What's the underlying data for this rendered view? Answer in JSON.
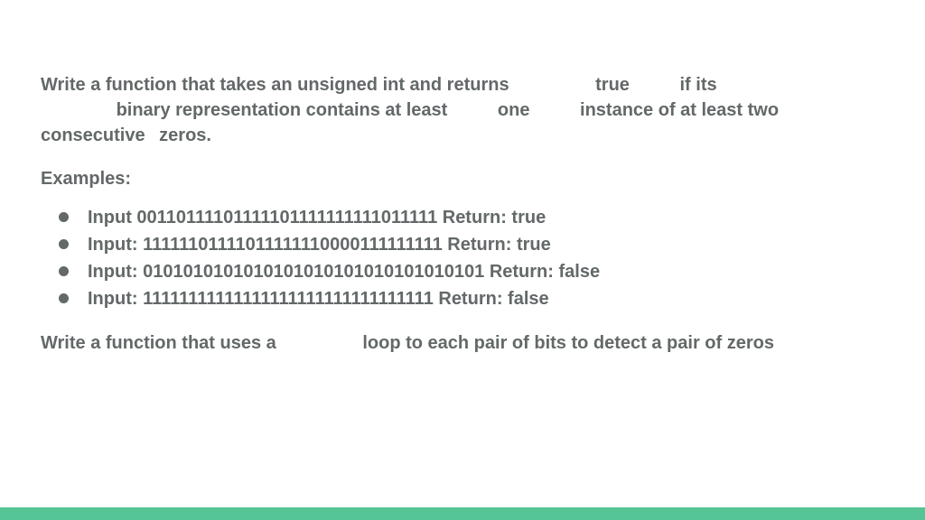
{
  "para1": {
    "f1": "Write a function that takes an unsigned int and returns",
    "f2": "true",
    "f3": "if its",
    "f4": "binary representation contains at least",
    "f5": "one",
    "f6": "instance of at least two consecutive",
    "f7": "zeros."
  },
  "examples_label": "Examples:",
  "examples": [
    "Input 00110111101111101111111111011111 Return: true",
    "Input: 11111101111011111110000111111111 Return: true",
    "Input: 0101010101010101010101010101010101 Return: false",
    "Input: 11111111111111111111111111111111 Return: false"
  ],
  "para2": {
    "f1": "Write a function that uses a",
    "f2": "loop to each pair of bits to detect a pair of zeros"
  },
  "accent_color": "#56c596"
}
